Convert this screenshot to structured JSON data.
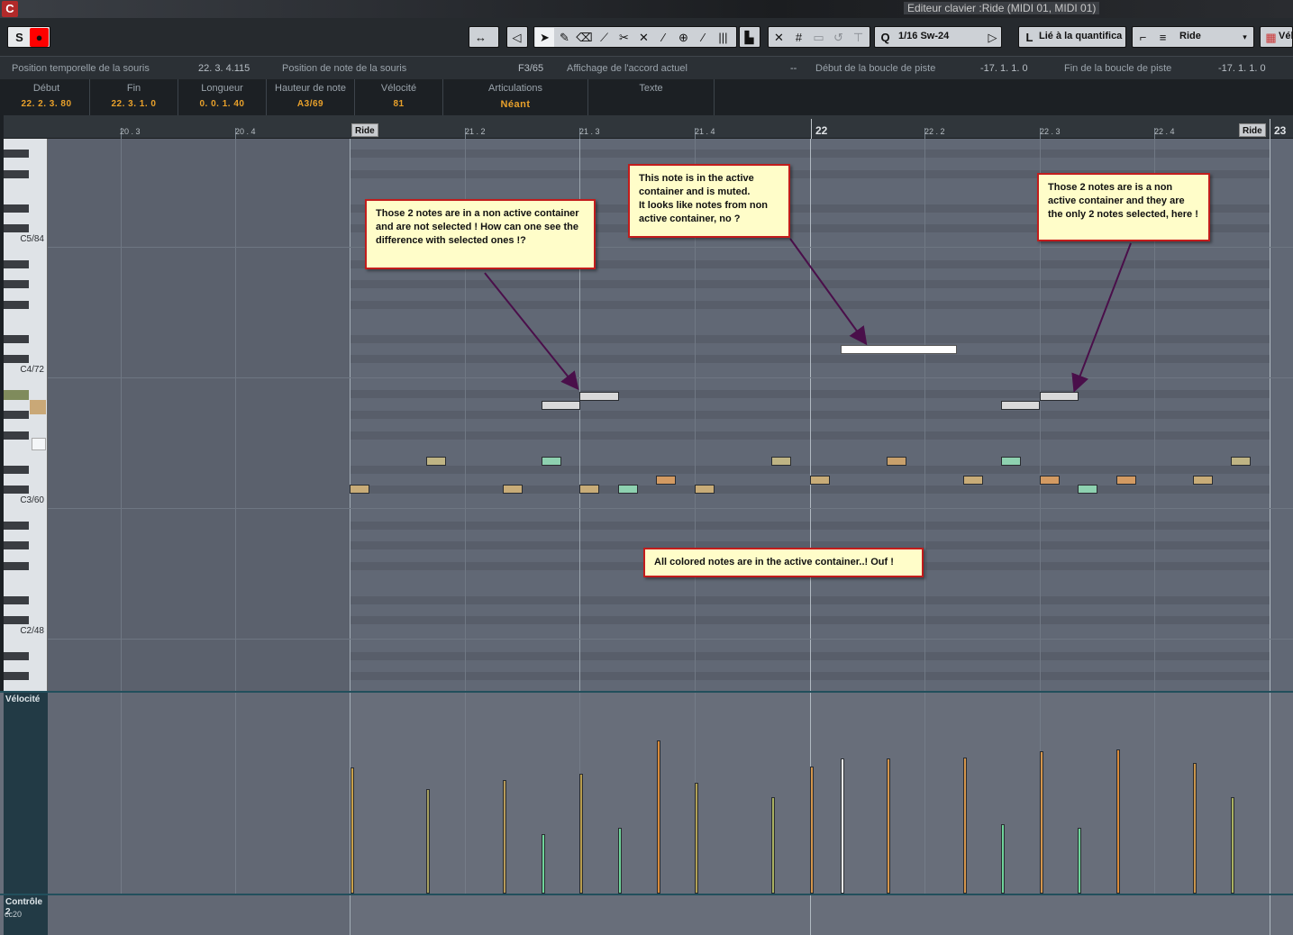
{
  "window": {
    "title": "Editeur clavier :Ride (MIDI 01, MIDI 01)"
  },
  "toolbar": {
    "solo_label": "S",
    "record_label": "●",
    "quantize_label": "Q",
    "quantize_value": "1/16 Sw-24",
    "length_label": "L",
    "length_value": "Lié à la quantifica",
    "track_value": "Ride",
    "color_value": "Vél"
  },
  "info_line": {
    "mouse_time_label": "Position temporelle de la souris",
    "mouse_time_value": "22. 3. 4.115",
    "mouse_note_label": "Position de note de la souris",
    "mouse_note_value": "F3/65",
    "chord_label": "Affichage de l'accord actuel",
    "chord_value": "--",
    "loop_start_label": "Début de la boucle de piste",
    "loop_start_value": "-17. 1. 1.   0",
    "loop_end_label": "Fin de la boucle de piste",
    "loop_end_value": "-17. 1. 1.   0"
  },
  "note_info": {
    "columns": [
      {
        "label": "Début",
        "value": "22. 2. 3. 80"
      },
      {
        "label": "Fin",
        "value": "22. 3. 1.   0"
      },
      {
        "label": "Longueur",
        "value": "0. 0. 1. 40"
      },
      {
        "label": "Hauteur de note",
        "value": "A3/69"
      },
      {
        "label": "Vélocité",
        "value": "81"
      },
      {
        "label": "Articulations",
        "value": "Néant"
      },
      {
        "label": "Texte",
        "value": ""
      }
    ]
  },
  "ruler": {
    "labels": [
      "20 . 3",
      "20 . 4",
      "21 . 2",
      "21 . 3",
      "21 . 4",
      "22",
      "22 . 2",
      "22 . 3",
      "22 . 4",
      "23"
    ],
    "part_name_start": "Ride",
    "part_name_end": "Ride"
  },
  "keyboard": {
    "octave_labels": [
      "C5/84",
      "C4/72",
      "C3/60",
      "C2/48"
    ]
  },
  "annotations": [
    "Those 2 notes are in a non active container and are not selected ! How can one see the difference with selected ones !?",
    "This note is in the active container and is muted.\nIt looks like notes from non active container, no ?",
    "Those 2 notes are is a non active container and they are the only 2 notes selected, here !",
    "All colored notes are in the active container..! Ouf !"
  ],
  "lanes": {
    "velocity_label": "Vélocité",
    "controller_label": "Contrôle 2",
    "controller_sub": "cc20"
  },
  "colors": {
    "note_yellow": "#bfb484",
    "note_orange": "#d39a62",
    "note_teal": "#8ed1b0",
    "note_tan": "#c8ac78",
    "note_gray": "#d9d9d9",
    "note_muted": "#ffffff",
    "callout_bg": "#fffdc9",
    "callout_border": "#c21c1c",
    "arrow": "#4a0f4a"
  }
}
